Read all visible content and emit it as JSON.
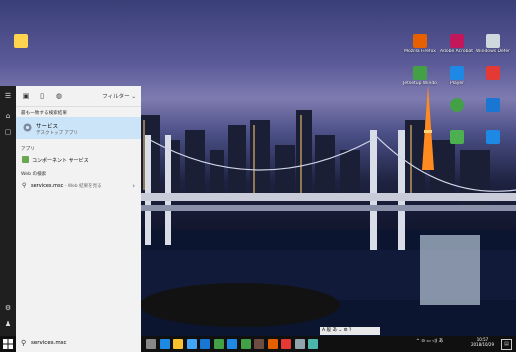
{
  "desktop": {
    "icons": [
      {
        "name": "recycle-bin-icon",
        "label": "",
        "color": "#ffd54f"
      },
      {
        "name": "firefox-icon",
        "label": "Mozilla Firefox",
        "color": "#e66000"
      },
      {
        "name": "adobe-icon",
        "label": "Adobe Acrobat DC",
        "color": "#c2185b"
      },
      {
        "name": "windows-defender-icon",
        "label": "Windows Defender",
        "color": "#cfd8dc"
      },
      {
        "name": "setup-icon",
        "label": "Jetsetup Windows",
        "color": "#43a047"
      },
      {
        "name": "chrome-icon",
        "label": "Google Chrome",
        "color": "#43a047"
      },
      {
        "name": "media-player-icon",
        "label": "Player",
        "color": "#1e88e5"
      },
      {
        "name": "shield-icon",
        "label": "",
        "color": "#e53935"
      },
      {
        "name": "doc-icon",
        "label": "",
        "color": "#4caf50"
      },
      {
        "name": "windows-icon",
        "label": "",
        "color": "#1976d2"
      },
      {
        "name": "ie-icon",
        "label": "",
        "color": "#1e88e5"
      }
    ]
  },
  "rail": {
    "menu_icon": "☰",
    "home_icon": "⌂",
    "docs_icon": "▢",
    "settings_icon": "⚙",
    "user_icon": "♟"
  },
  "panel": {
    "top_icons": [
      "▣",
      "▯",
      "◍"
    ],
    "filter_label": "フィルター",
    "best_match_header": "最も一致する検索結果",
    "best_match_title": "サービス",
    "best_match_subtitle": "デスクトップ アプリ",
    "apps_header": "アプリ",
    "app_item": "コンポーネント サービス",
    "web_header": "Web の検索",
    "web_query": "services.msc",
    "web_suffix": " - Web 結果を見る"
  },
  "taskbar": {
    "search_text": "services.msc",
    "clock_time": "10:57",
    "clock_date": "2018/10/29",
    "tray_text": "^ ⊙ ▭ ◁) あ",
    "ime_text": "A 般 あ ⌄ ⚙ ?",
    "notification_icon": "▤",
    "app_icons": [
      {
        "name": "task-view-icon",
        "color": "#888888"
      },
      {
        "name": "edge-icon",
        "color": "#1e88e5"
      },
      {
        "name": "explorer-icon",
        "color": "#fbc02d"
      },
      {
        "name": "store-icon",
        "color": "#42a5f5"
      },
      {
        "name": "mail-icon",
        "color": "#1976d2"
      },
      {
        "name": "chrome-taskbar-icon",
        "color": "#43a047"
      },
      {
        "name": "photos-icon",
        "color": "#1e88e5"
      },
      {
        "name": "app-icon-8",
        "color": "#43a047"
      },
      {
        "name": "app-icon-9",
        "color": "#6d4c41"
      },
      {
        "name": "firefox-taskbar-icon",
        "color": "#e66000"
      },
      {
        "name": "app-icon-11",
        "color": "#e53935"
      },
      {
        "name": "app-icon-12",
        "color": "#90a4ae"
      },
      {
        "name": "app-icon-13",
        "color": "#4db6ac"
      }
    ]
  }
}
